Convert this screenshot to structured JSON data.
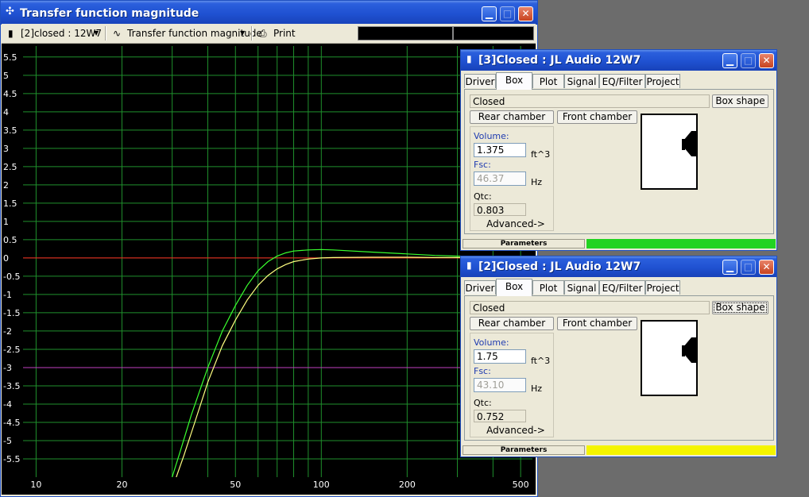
{
  "main_window": {
    "title": "Transfer function magnitude",
    "toolbar": {
      "project_selector": "[2]closed : 12W7",
      "plot_selector": "Transfer function magnitude",
      "print_label": "Print"
    }
  },
  "chart_data": {
    "type": "line",
    "x_scale": "log",
    "xlim": [
      9,
      550
    ],
    "ylim": [
      -6,
      5.8
    ],
    "x_tick_labels": [
      "10",
      "20",
      "50",
      "100",
      "200",
      "500"
    ],
    "x_tick_values": [
      10,
      20,
      50,
      100,
      200,
      500
    ],
    "y_tick_values": [
      5.5,
      5,
      4.5,
      4,
      3.5,
      3,
      2.5,
      2,
      1.5,
      1,
      0.5,
      0,
      -0.5,
      -1,
      -1.5,
      -2,
      -2.5,
      -3,
      -3.5,
      -4,
      -4.5,
      -5,
      -5.5
    ],
    "y_tick_labels": [
      "5.5",
      "5",
      "4.5",
      "4",
      "3.5",
      "3",
      "2.5",
      "2",
      "1.5",
      "1",
      "0.5",
      "0",
      "-0.5",
      "-1",
      "-1.5",
      "-2",
      "-2.5",
      "-3",
      "-3.5",
      "-4",
      "-4.5",
      "-5",
      "-5.5"
    ],
    "grid": true,
    "reference_lines": [
      {
        "y": 0,
        "color": "#ff2020"
      },
      {
        "y": -3,
        "color": "#c040c0"
      }
    ],
    "series": [
      {
        "color": "#39ff2e",
        "x": [
          30,
          32,
          35,
          40,
          45,
          50,
          55,
          60,
          65,
          70,
          75,
          80,
          90,
          100,
          110,
          150,
          200,
          250,
          300,
          400,
          500
        ],
        "y": [
          -6,
          -5.3,
          -4.3,
          -3.0,
          -2.0,
          -1.3,
          -0.75,
          -0.35,
          -0.1,
          0.05,
          0.14,
          0.19,
          0.22,
          0.23,
          0.22,
          0.16,
          0.11,
          0.07,
          0.05,
          0.02,
          0.01
        ]
      },
      {
        "color": "#ffff80",
        "x": [
          31,
          33,
          36,
          40,
          45,
          50,
          55,
          60,
          65,
          70,
          75,
          80,
          90,
          100,
          110,
          150,
          200,
          250,
          300,
          400,
          500
        ],
        "y": [
          -6,
          -5.4,
          -4.5,
          -3.4,
          -2.4,
          -1.7,
          -1.15,
          -0.75,
          -0.48,
          -0.3,
          -0.18,
          -0.1,
          -0.03,
          0.0,
          0.01,
          0.02,
          0.02,
          0.01,
          0.01,
          0.0,
          0.0
        ]
      }
    ]
  },
  "box_windows": [
    {
      "title": "[3]Closed : JL Audio 12W7",
      "tabs": [
        "Driver",
        "Box",
        "Plot",
        "Signal",
        "EQ/Filter",
        "Project"
      ],
      "active_tab": "Box",
      "box_type": "Closed",
      "box_shape_button": "Box shape",
      "rear_chamber_button": "Rear chamber",
      "front_chamber_button": "Front chamber",
      "volume_label": "Volume:",
      "volume_value": "1.375",
      "volume_unit": "ft^3",
      "fsc_label": "Fsc:",
      "fsc_value": "46.37",
      "fsc_unit": "Hz",
      "qtc_label": "Qtc:",
      "qtc_value": "0.803",
      "advanced_button": "Advanced->",
      "status_label": "Parameters",
      "status_color": "#22d322"
    },
    {
      "title": "[2]Closed : JL Audio 12W7",
      "tabs": [
        "Driver",
        "Box",
        "Plot",
        "Signal",
        "EQ/Filter",
        "Project"
      ],
      "active_tab": "Box",
      "box_type": "Closed",
      "box_shape_button": "Box shape",
      "rear_chamber_button": "Rear chamber",
      "front_chamber_button": "Front chamber",
      "volume_label": "Volume:",
      "volume_value": "1.75",
      "volume_unit": "ft^3",
      "fsc_label": "Fsc:",
      "fsc_value": "43.10",
      "fsc_unit": "Hz",
      "qtc_label": "Qtc:",
      "qtc_value": "0.752",
      "advanced_button": "Advanced->",
      "status_label": "Parameters",
      "status_color": "#f4f400"
    }
  ]
}
